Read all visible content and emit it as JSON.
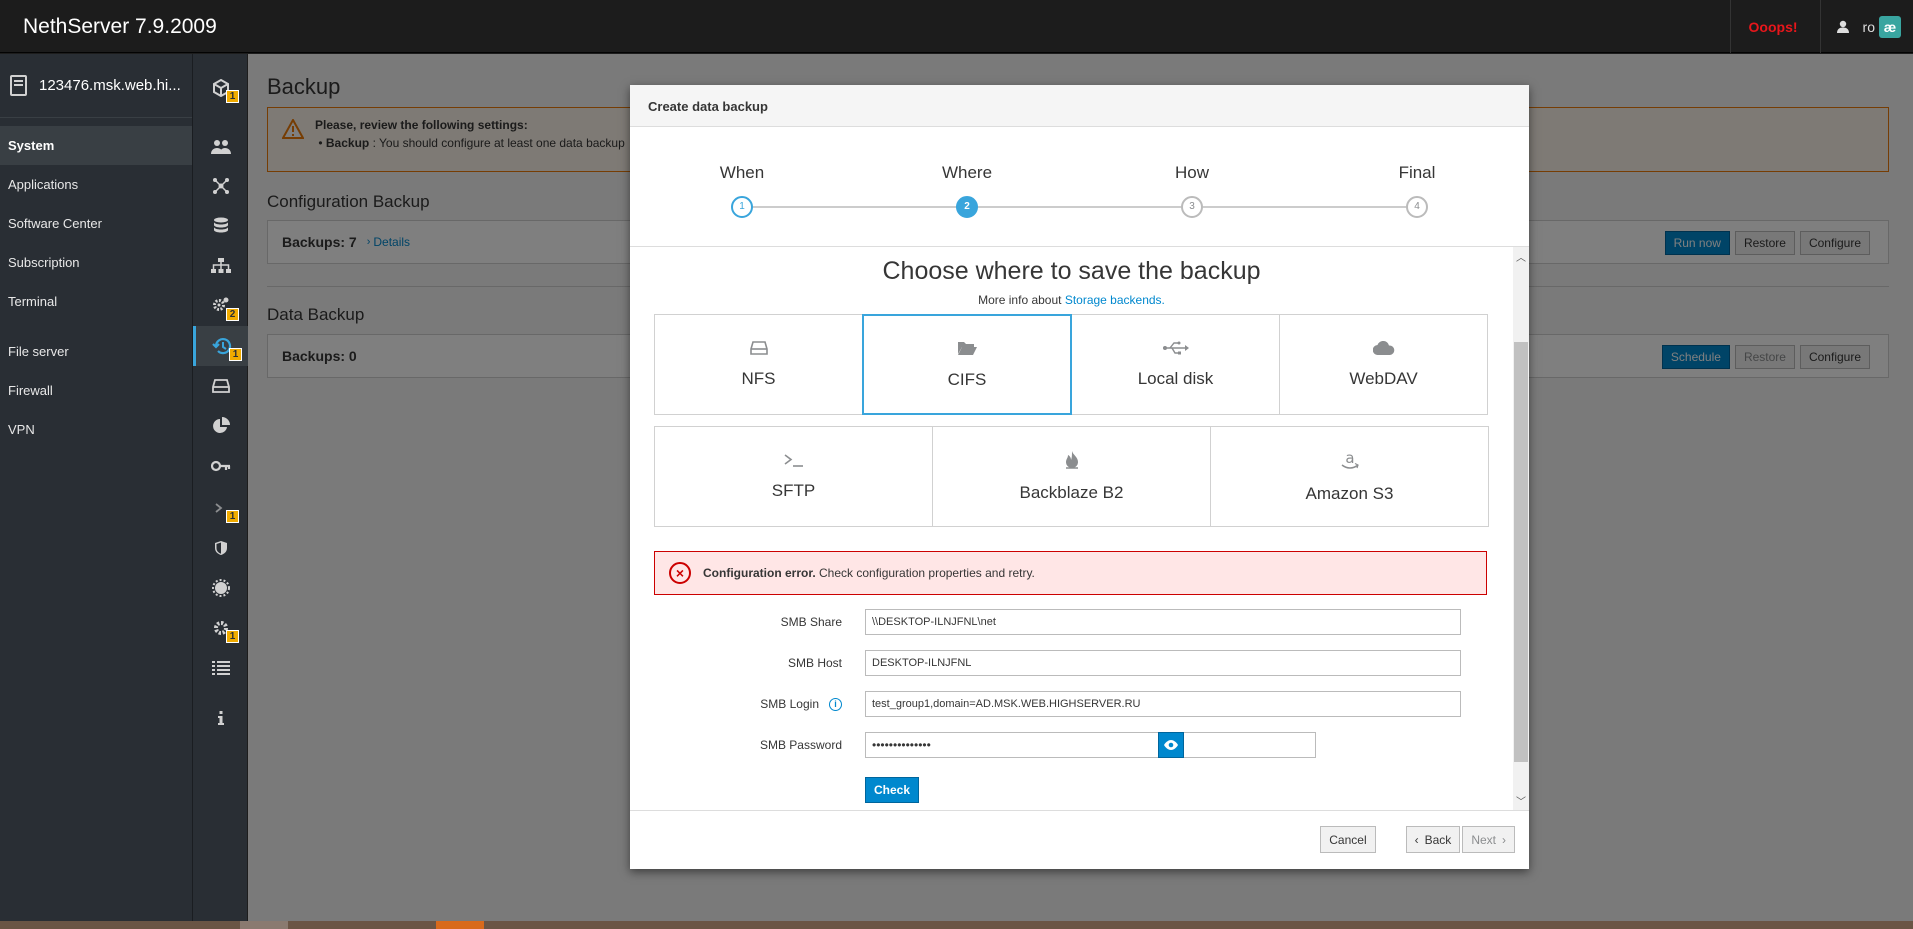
{
  "app": {
    "brand": "NethServer 7.9.2009",
    "alert_label": "Ooops!",
    "user_label": "ro",
    "avatar_text": "æ"
  },
  "sidebar": {
    "hostname": "123476.msk.web.hi...",
    "items": [
      {
        "label": "System"
      },
      {
        "label": "Applications"
      },
      {
        "label": "Software Center"
      },
      {
        "label": "Subscription"
      },
      {
        "label": "Terminal"
      },
      {
        "label": "File server"
      },
      {
        "label": "Firewall"
      },
      {
        "label": "VPN"
      }
    ]
  },
  "iconbar": {
    "badges": {
      "cube": "1",
      "gears": "2",
      "backup": "1",
      "terminal": "1",
      "settings": "1"
    }
  },
  "page": {
    "title": "Backup",
    "warning_title": "Please, review the following settings:",
    "warning_item_key": "Backup",
    "warning_item_text": " : You should configure at least one data backup",
    "config_section": "Configuration Backup",
    "config_backups": "Backups: 7",
    "details_link": "Details",
    "data_section": "Data Backup",
    "data_backups": "Backups: 0",
    "btn_run_now": "Run now",
    "btn_restore": "Restore",
    "btn_configure": "Configure",
    "btn_schedule": "Schedule"
  },
  "modal": {
    "title": "Create data backup",
    "steps": [
      {
        "label": "When",
        "num": "1"
      },
      {
        "label": "Where",
        "num": "2"
      },
      {
        "label": "How",
        "num": "3"
      },
      {
        "label": "Final",
        "num": "4"
      }
    ],
    "heading": "Choose where to save the backup",
    "more_info_prefix": "More info about ",
    "more_info_link": "Storage backends.",
    "backends": [
      {
        "label": "NFS",
        "icon": "hard-drive-icon"
      },
      {
        "label": "CIFS",
        "icon": "folder-open-icon"
      },
      {
        "label": "Local disk",
        "icon": "usb-icon"
      },
      {
        "label": "WebDAV",
        "icon": "cloud-icon"
      },
      {
        "label": "SFTP",
        "icon": "terminal-icon"
      },
      {
        "label": "Backblaze B2",
        "icon": "flame-icon"
      },
      {
        "label": "Amazon S3",
        "icon": "amazon-icon"
      }
    ],
    "selected_backend": "CIFS",
    "error_bold": "Configuration error.",
    "error_text": " Check configuration properties and retry.",
    "fields": {
      "smb_share_label": "SMB Share",
      "smb_share_value": "\\\\DESKTOP-ILNJFNL\\net",
      "smb_host_label": "SMB Host",
      "smb_host_value": "DESKTOP-ILNJFNL",
      "smb_login_label": "SMB Login",
      "smb_login_value": "test_group1,domain=AD.MSK.WEB.HIGHSERVER.RU",
      "smb_password_label": "SMB Password",
      "smb_password_value": "••••••••••••••"
    },
    "check_label": "Check",
    "cancel_label": "Cancel",
    "back_label": "Back",
    "next_label": "Next"
  },
  "colors": {
    "accent": "#39a5dc",
    "primary_button": "#0088ce",
    "warning": "#ec7a08",
    "error": "#cc0000",
    "badge": "#f0ab00"
  }
}
